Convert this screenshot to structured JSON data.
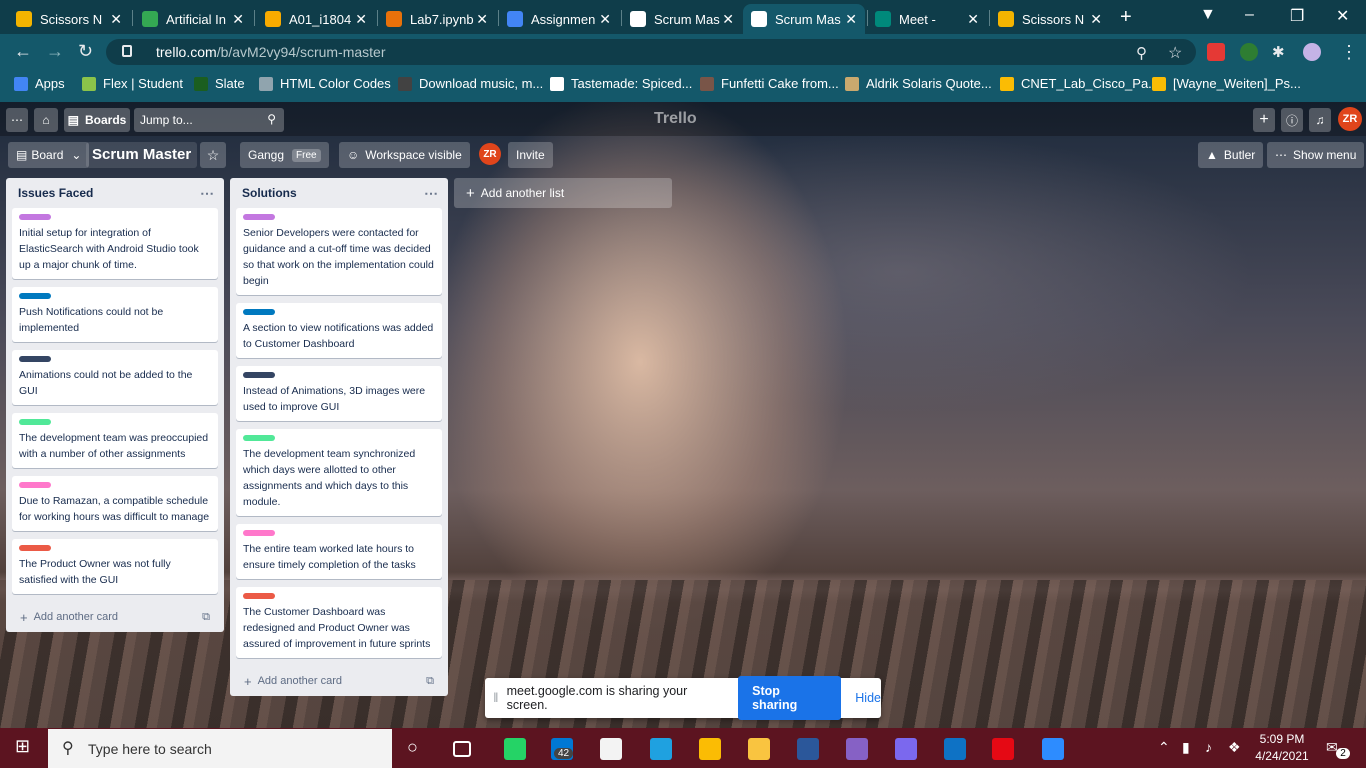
{
  "browser": {
    "tabs": [
      {
        "title": "Scissors N",
        "color": "#f4b400"
      },
      {
        "title": "Artificial In",
        "color": "#34a853"
      },
      {
        "title": "A01_i1804",
        "color": "#f9ab00"
      },
      {
        "title": "Lab7.ipynb",
        "color": "#e8710a"
      },
      {
        "title": "Assignmen",
        "color": "#4285f4"
      },
      {
        "title": "Scrum Mas",
        "color": "#ffffff"
      },
      {
        "title": "Scrum Mas",
        "color": "#ffffff"
      },
      {
        "title": "Meet -",
        "color": "#00897b"
      },
      {
        "title": "Scissors N",
        "color": "#f4b400"
      }
    ],
    "url_host": "trello.com",
    "url_path": "/b/avM2vy94/scrum-master",
    "bookmarks": [
      {
        "label": "Apps",
        "color": "#4285f4"
      },
      {
        "label": "Flex | Student",
        "color": "#8bc34a"
      },
      {
        "label": "Slate",
        "color": "#1b5e20"
      },
      {
        "label": "HTML Color Codes",
        "color": "#90a4ae"
      },
      {
        "label": "Download music, m...",
        "color": "#424242"
      },
      {
        "label": "Tastemade: Spiced...",
        "color": "#ffffff"
      },
      {
        "label": "Funfetti Cake from...",
        "color": "#795548"
      },
      {
        "label": "Aldrik Solaris Quote...",
        "color": "#c9a96e"
      },
      {
        "label": "CNET_Lab_Cisco_Pa...",
        "color": "#fbbc04"
      },
      {
        "label": "[Wayne_Weiten]_Ps...",
        "color": "#fbbc04"
      }
    ]
  },
  "trello": {
    "boards_label": "Boards",
    "jump_placeholder": "Jump to...",
    "logo": "Trello",
    "user_initials": "ZR",
    "view_label": "Board",
    "board_title": "Scrum Master",
    "workspace": "Gangg",
    "plan_badge": "Free",
    "visibility": "Workspace visible",
    "invite": "Invite",
    "butler": "Butler",
    "show_menu": "Show menu",
    "add_list": "Add another list",
    "add_card": "Add another card",
    "lists": [
      {
        "title": "Issues Faced",
        "cards": [
          {
            "label_color": "#c377e0",
            "text": "Initial setup for integration of ElasticSearch with Android Studio took up a major chunk of time."
          },
          {
            "label_color": "#0079bf",
            "text": "Push Notifications could not be implemented"
          },
          {
            "label_color": "#344563",
            "text": "Animations could not be added to the GUI"
          },
          {
            "label_color": "#51e898",
            "text": "The development team was preoccupied with a number of other assignments"
          },
          {
            "label_color": "#ff78cb",
            "text": "Due to Ramazan, a compatible schedule for working hours was difficult to manage"
          },
          {
            "label_color": "#eb5a46",
            "text": "The Product Owner was not fully satisfied with the GUI"
          }
        ]
      },
      {
        "title": "Solutions",
        "cards": [
          {
            "label_color": "#c377e0",
            "text": "Senior Developers were contacted for guidance and a cut-off time was decided so that work on the implementation could begin"
          },
          {
            "label_color": "#0079bf",
            "text": "A section to view notifications was added to Customer Dashboard"
          },
          {
            "label_color": "#344563",
            "text": "Instead of Animations, 3D images were used to improve GUI"
          },
          {
            "label_color": "#51e898",
            "text": "The development team synchronized which days were allotted to other assignments and which days to this module."
          },
          {
            "label_color": "#ff78cb",
            "text": "The entire team worked late hours to ensure timely completion of the tasks"
          },
          {
            "label_color": "#eb5a46",
            "text": "The Customer Dashboard was redesigned and Product Owner was assured of improvement in future sprints"
          }
        ]
      }
    ]
  },
  "share_bar": {
    "message": "meet.google.com is sharing your screen.",
    "stop": "Stop sharing",
    "hide": "Hide"
  },
  "taskbar": {
    "search_placeholder": "Type here to search",
    "mail_badge": "42",
    "time": "5:09 PM",
    "date": "4/24/2021",
    "notif_count": "2",
    "apps": [
      {
        "name": "task-view-icon",
        "color": "#ffffff"
      },
      {
        "name": "whatsapp-icon",
        "color": "#25d366"
      },
      {
        "name": "mail-icon",
        "color": "#0078d4"
      },
      {
        "name": "store-icon",
        "color": "#f3f3f3"
      },
      {
        "name": "edge-icon",
        "color": "#1fa1e0"
      },
      {
        "name": "chrome-icon",
        "color": "#fbbc04"
      },
      {
        "name": "file-explorer-icon",
        "color": "#f9c440"
      },
      {
        "name": "word-icon",
        "color": "#2b579a"
      },
      {
        "name": "visual-studio-icon",
        "color": "#8661c5"
      },
      {
        "name": "game-icon",
        "color": "#7b68ee"
      },
      {
        "name": "browser-icon",
        "color": "#0e72c5"
      },
      {
        "name": "netflix-icon",
        "color": "#e50914"
      },
      {
        "name": "zoom-icon",
        "color": "#2d8cff"
      }
    ]
  }
}
